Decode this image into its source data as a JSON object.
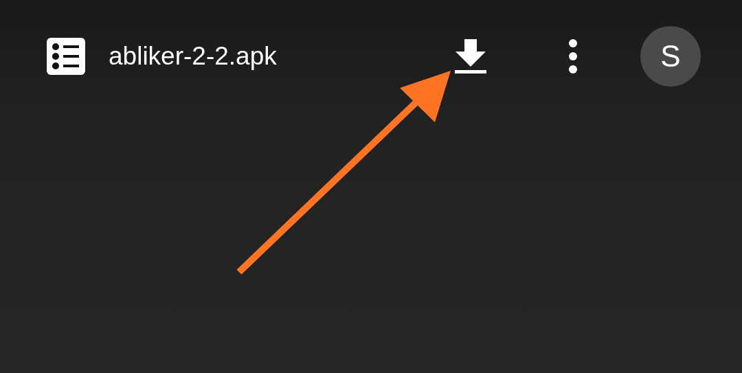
{
  "toolbar": {
    "title": "abliker-2-2.apk",
    "avatar": {
      "initial": "S"
    }
  }
}
